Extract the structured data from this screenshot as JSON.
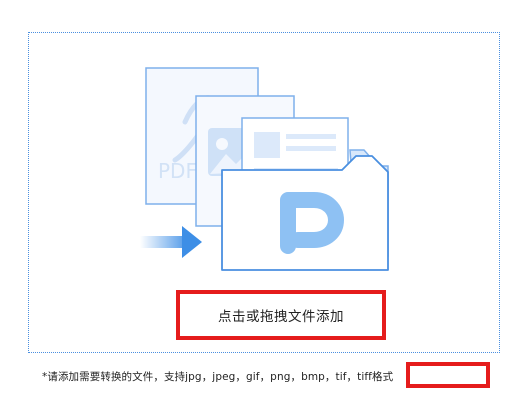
{
  "upload": {
    "cta_label": "点击或拖拽文件添加",
    "hint": "*请添加需要转换的文件，支持jpg，jpeg，gif，png，bmp，tif，tiff格式",
    "pdf_doc_text": "PDF"
  },
  "icons": [
    "pdf-document-icon",
    "image-document-icon",
    "text-document-icon",
    "folder-icon",
    "arrow-right-icon"
  ],
  "colors": {
    "accent": "#4a8fe0",
    "highlight_border": "#e51c1c"
  }
}
